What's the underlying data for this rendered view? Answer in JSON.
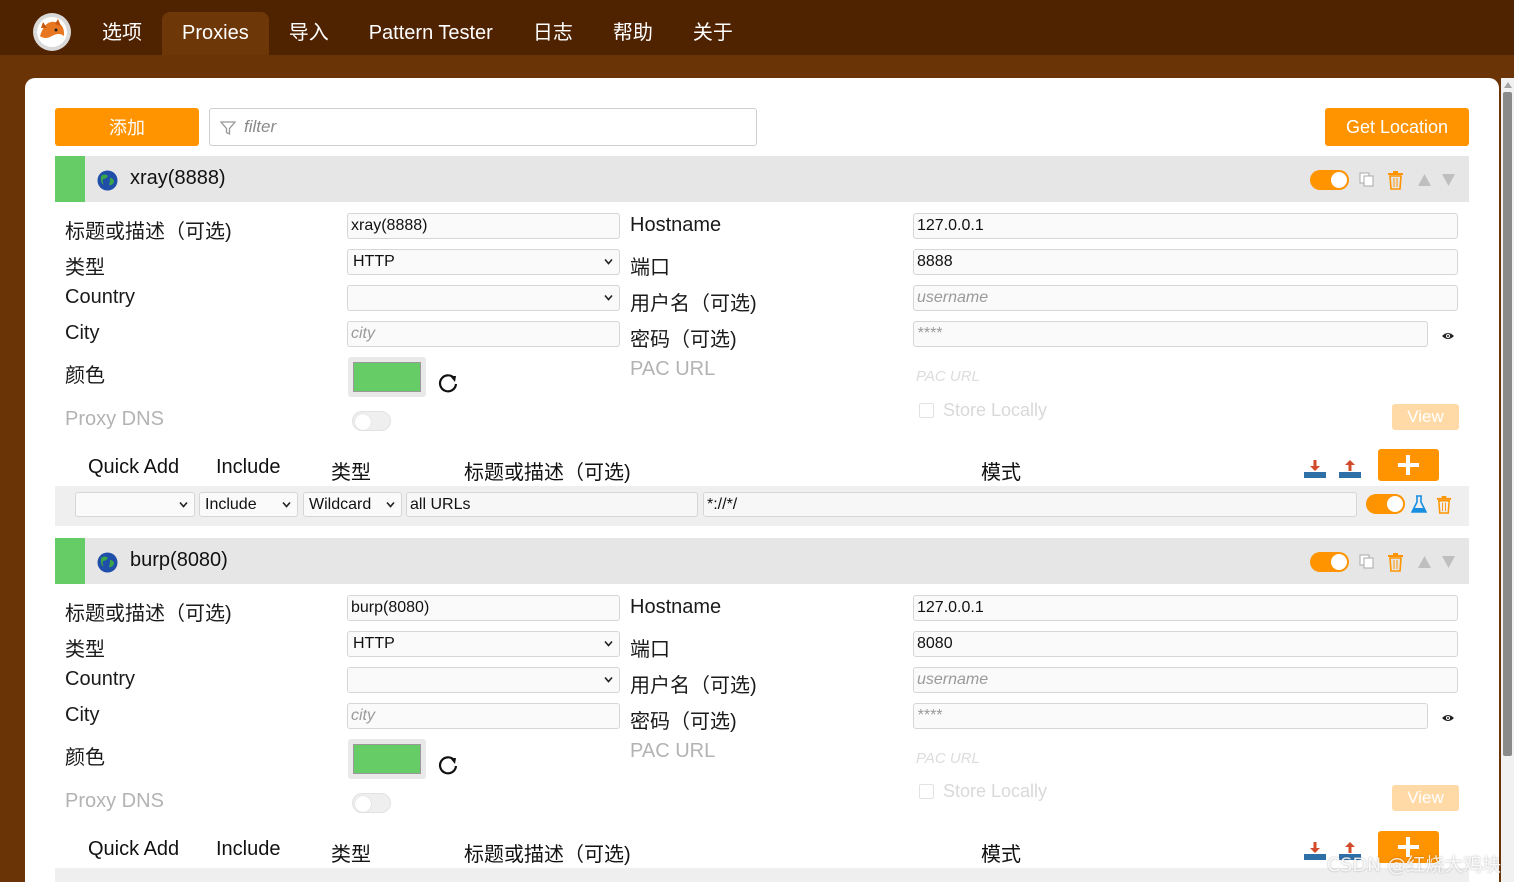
{
  "nav": {
    "tabs": [
      {
        "label": "选项",
        "active": false
      },
      {
        "label": "Proxies",
        "active": true
      },
      {
        "label": "导入",
        "active": false
      },
      {
        "label": "Pattern Tester",
        "active": false
      },
      {
        "label": "日志",
        "active": false
      },
      {
        "label": "帮助",
        "active": false
      },
      {
        "label": "关于",
        "active": false
      }
    ]
  },
  "toolbar": {
    "add_label": "添加",
    "filter_placeholder": "filter",
    "get_location_label": "Get Location"
  },
  "labels": {
    "title": "标题或描述（可选)",
    "type": "类型",
    "country": "Country",
    "city": "City",
    "color": "颜色",
    "proxy_dns": "Proxy DNS",
    "hostname": "Hostname",
    "port": "端口",
    "username": "用户名（可选)",
    "password": "密码（可选)",
    "pac_url": "PAC URL",
    "store_locally": "Store Locally",
    "view": "View",
    "city_placeholder": "city",
    "username_placeholder": "username",
    "password_placeholder": "****",
    "pac_placeholder": "PAC URL"
  },
  "pattern_header": {
    "quick_add": "Quick Add",
    "include": "Include",
    "type": "类型",
    "title": "标题或描述（可选)",
    "pattern": "模式"
  },
  "proxies": [
    {
      "name": "xray(8888)",
      "enabled": true,
      "title": "xray(8888)",
      "type": "HTTP",
      "country": "",
      "hostname": "127.0.0.1",
      "port": "8888",
      "color": "#66cc66",
      "patterns": [
        {
          "quick_add": "",
          "include": "Include",
          "type": "Wildcard",
          "title": "all URLs",
          "pattern": "*://*/",
          "enabled": true
        }
      ]
    },
    {
      "name": "burp(8080)",
      "enabled": true,
      "title": "burp(8080)",
      "type": "HTTP",
      "country": "",
      "hostname": "127.0.0.1",
      "port": "8080",
      "color": "#66cc66",
      "patterns": []
    }
  ],
  "watermark": "CSDN @红烧大鸡块",
  "colors": {
    "nav_bg": "#4f2200",
    "accent": "#ff9400",
    "proxy_stripe": "#66cc66"
  }
}
